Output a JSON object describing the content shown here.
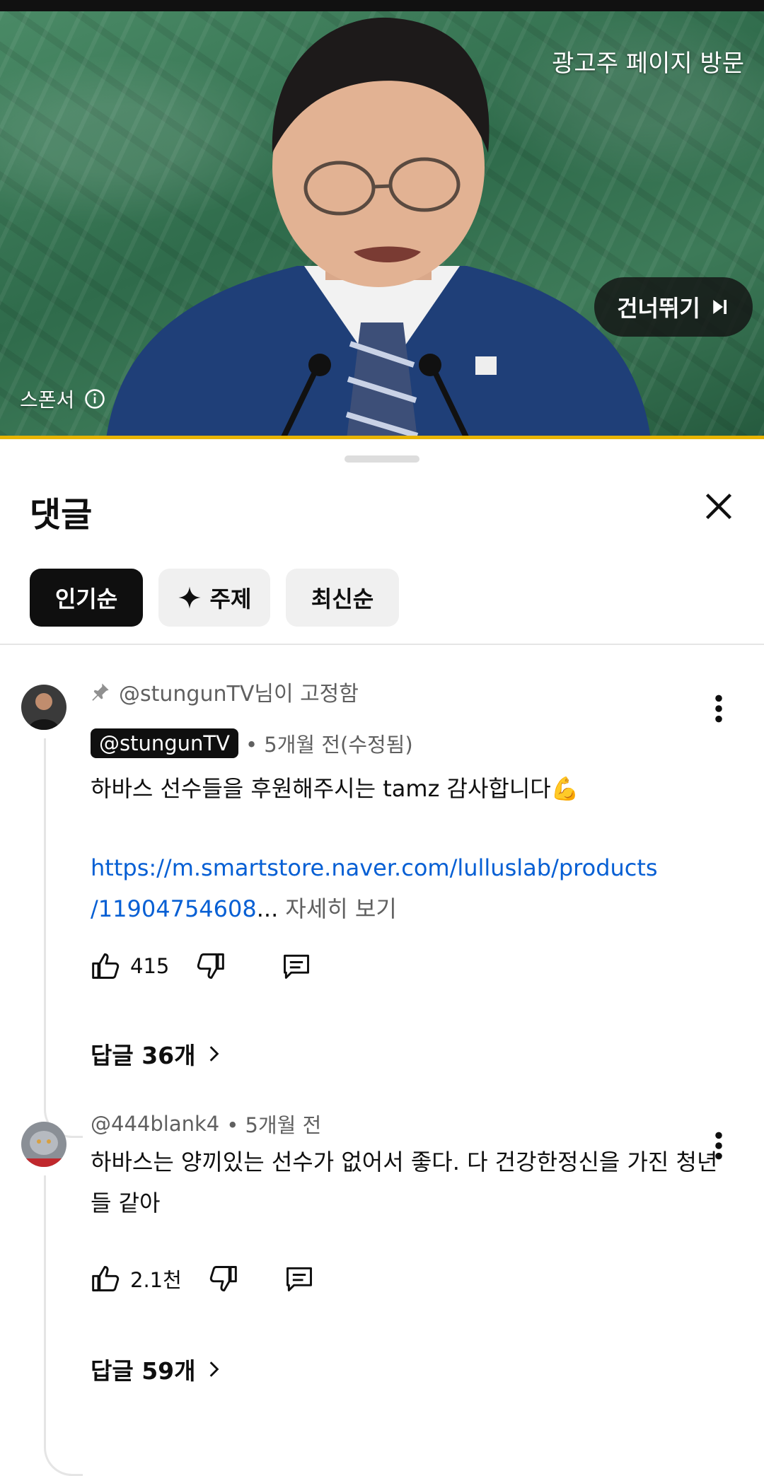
{
  "ad": {
    "visit_label": "광고주 페이지 방문",
    "skip_label": "건너뛰기",
    "sponsor_label": "스폰서"
  },
  "comments_sheet": {
    "title": "댓글",
    "chips": [
      {
        "label": "인기순",
        "active": true
      },
      {
        "label": "주제",
        "active": false
      },
      {
        "label": "최신순",
        "active": false
      }
    ]
  },
  "comments": [
    {
      "pinned_text": "@stungunTV님이 고정함",
      "author": "@stungunTV",
      "time": "• 5개월 전(수정됨)",
      "text_line1": "하바스 선수들을 후원해주시는 tamz 감사합니다💪",
      "link_line1": "https://m.smartstore.naver.com/lulluslab/products",
      "link_line2": "/11904754608",
      "ellipsis": "...",
      "read_more": "자세히 보기",
      "likes": "415",
      "replies": "답글 36개"
    },
    {
      "author": "@444blank4",
      "time": "• 5개월 전",
      "text": "하바스는 양끼있는 선수가 없어서 좋다. 다 건강한정신을 가진 청년들 같아",
      "likes": "2.1천",
      "replies": "답글 59개"
    }
  ]
}
